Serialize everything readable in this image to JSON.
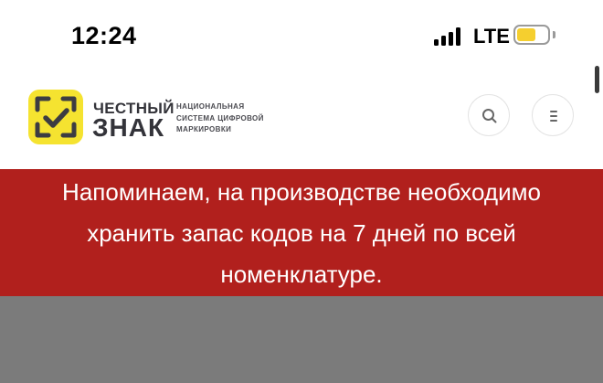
{
  "status_bar": {
    "time": "12:24",
    "network": "LTE",
    "battery_color": "#f5cf2f"
  },
  "header": {
    "logo": {
      "word1": "ЧЕСТНЫЙ",
      "word2": "ЗНАК",
      "tagline": [
        "НАЦИОНАЛЬНАЯ",
        "СИСТЕМА ЦИФРОВОЙ",
        "МАРКИРОВКИ"
      ],
      "icon": "checkmark-frame-icon",
      "color": "#f5e330"
    },
    "buttons": [
      {
        "name": "search-button",
        "icon": "search-icon"
      },
      {
        "name": "menu-button",
        "icon": "menu-icon"
      }
    ]
  },
  "banner": {
    "text": "Напоминаем, на производстве необходимо хранить запас кодов на 7 дней по всей номенклатуре.",
    "color": "#b1201d"
  },
  "overlay": {
    "color": "#7b7b7b"
  }
}
